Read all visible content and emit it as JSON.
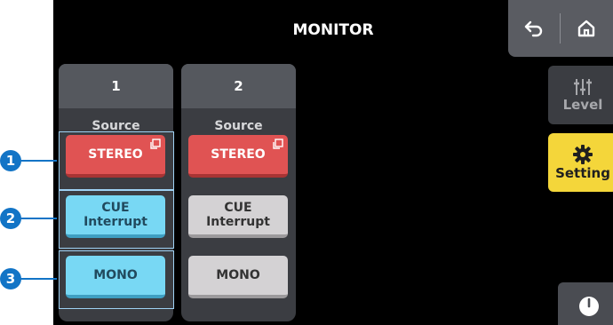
{
  "header": {
    "title": "MONITOR"
  },
  "strips": [
    {
      "number": "1",
      "source_label": "Source",
      "stereo": "STEREO",
      "cue_line1": "CUE",
      "cue_line2": "Interrupt",
      "mono": "MONO"
    },
    {
      "number": "2",
      "source_label": "Source",
      "stereo": "STEREO",
      "cue_line1": "CUE",
      "cue_line2": "Interrupt",
      "mono": "MONO"
    }
  ],
  "sidebar": {
    "level_label": "Level",
    "setting_label": "Setting"
  },
  "callouts": [
    "1",
    "2",
    "3"
  ],
  "colors": {
    "stereo": "#e05353",
    "active": "#78d8f4",
    "inactive": "#d4d2d4",
    "setting": "#f4d63a",
    "callout": "#1274c6"
  },
  "icons": [
    "back-arrow-icon",
    "home-icon",
    "sliders-icon",
    "gear-icon",
    "power-icon",
    "window-corner-icon"
  ]
}
